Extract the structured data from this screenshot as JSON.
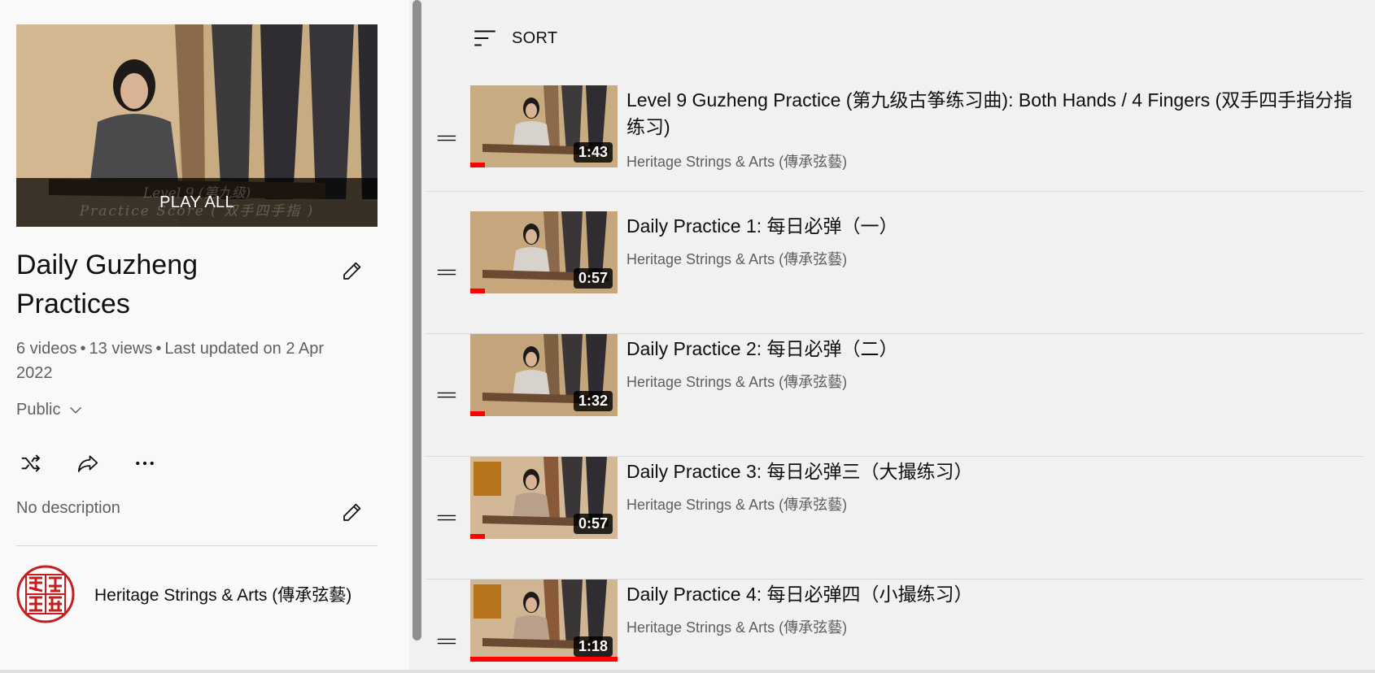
{
  "playlist": {
    "hero_overlay_text": [
      "Level 9 (第九级)",
      "Practice Score ( 双手四手指 )"
    ],
    "play_all_label": "PLAY ALL",
    "title": "Daily Guzheng Practices",
    "video_count": "6 videos",
    "views": "13 views",
    "updated": "Last updated on 2 Apr 2022",
    "separator": "•",
    "privacy": "Public",
    "description": "No description",
    "channel_name": "Heritage Strings & Arts (傳承弦藝)",
    "avatar_text": "傳承弦藝"
  },
  "sort": {
    "label": "SORT"
  },
  "videos": [
    {
      "title": "Level 9 Guzheng Practice (第九级古筝练习曲): Both Hands / 4 Fingers (双手四手指分指练习)",
      "channel": "Heritage Strings & Arts (傳承弦藝)",
      "duration": "1:43",
      "progress": 0.1
    },
    {
      "title": "Daily Practice 1: 每日必弹（一）",
      "channel": "Heritage Strings & Arts (傳承弦藝)",
      "duration": "0:57",
      "progress": 0.1
    },
    {
      "title": "Daily Practice 2: 每日必弹（二）",
      "channel": "Heritage Strings & Arts (傳承弦藝)",
      "duration": "1:32",
      "progress": 0.1
    },
    {
      "title": "Daily Practice 3: 每日必弹三（大撮练习）",
      "channel": "Heritage Strings & Arts (傳承弦藝)",
      "duration": "0:57",
      "progress": 0.1
    },
    {
      "title": "Daily Practice 4: 每日必弹四（小撮练习）",
      "channel": "Heritage Strings & Arts (傳承弦藝)",
      "duration": "1:18",
      "progress": 1.0
    }
  ],
  "icons": {
    "edit": "pencil-icon",
    "chevron": "chevron-down-icon",
    "shuffle": "shuffle-icon",
    "share": "share-icon",
    "more": "more-horizontal-icon",
    "sort": "sort-icon",
    "drag": "drag-handle-icon"
  },
  "colors": {
    "progress": "#ff0000",
    "avatar_seal": "#c41e1e"
  }
}
